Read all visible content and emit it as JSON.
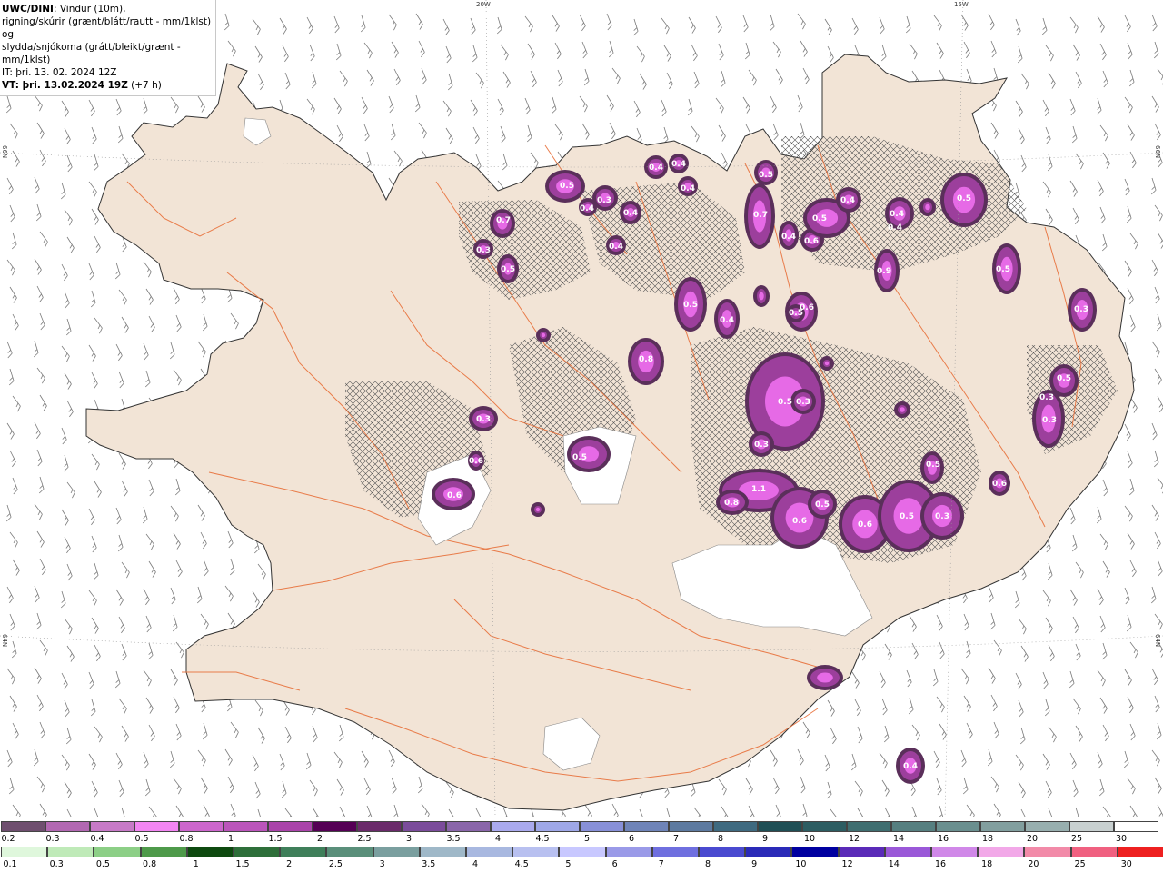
{
  "header": {
    "title_bold": "UWC/DINI",
    "title_rest": ": Vindur (10m),",
    "line2": "rigning/skúrir (grænt/blátt/rautt - mm/1klst) og",
    "line3": "slydda/snjókoma (grátt/bleikt/grænt - mm/1klst)",
    "line4": "IT: þri. 13. 02. 2024 12Z",
    "vt_bold": "VT: þri. 13.02.2024 19Z",
    "vt_rest": " (+7 h)"
  },
  "grid_labels": {
    "top_20w": "20W",
    "top_15w": "15W",
    "left_66n": "66N",
    "left_64n": "64N",
    "right_66n": "66N",
    "right_64n": "64N"
  },
  "colors": {
    "land": "#f2e4d6",
    "coast": "#333333",
    "roads": "#e8703a",
    "snow_dark": "#5a2f5a",
    "snow_mid": "#9c3f9c",
    "snow_light": "#e66ae6",
    "ice": "#ffffff",
    "wind_barb": "#7a7a7a"
  },
  "legend_top": {
    "labels": [
      "0.2",
      "0.3",
      "0.4",
      "0.5",
      "0.8",
      "1",
      "1.5",
      "2",
      "2.5",
      "3",
      "3.5",
      "4",
      "4.5",
      "5",
      "6",
      "7",
      "8",
      "9",
      "10",
      "12",
      "14",
      "16",
      "18",
      "20",
      "25",
      "30"
    ],
    "colors": [
      "#6f4f6f",
      "#b268b2",
      "#c77ac7",
      "#f285f2",
      "#cc66cc",
      "#bb55bb",
      "#aa44aa",
      "#550055",
      "#6a2a6a",
      "#7b4c9b",
      "#8a66aa",
      "#aaaaee",
      "#9fa8e8",
      "#8890d8",
      "#6f84b8",
      "#5d7aa0",
      "#3f6a80",
      "#1f4f55",
      "#2d5d62",
      "#3f6e70",
      "#567f80",
      "#6a8f8f",
      "#829f9f",
      "#98afaf",
      "#c8d0d0",
      "#ffffff"
    ]
  },
  "legend_bottom": {
    "labels": [
      "0.1",
      "0.3",
      "0.5",
      "0.8",
      "1",
      "1.5",
      "2",
      "2.5",
      "3",
      "3.5",
      "4",
      "4.5",
      "5",
      "6",
      "7",
      "8",
      "9",
      "10",
      "12",
      "14",
      "16",
      "18",
      "20",
      "25",
      "30"
    ],
    "colors": [
      "#dff7dc",
      "#bfeab8",
      "#8ccf86",
      "#4e9a4a",
      "#0e4a10",
      "#2e6f3a",
      "#3f7f5a",
      "#5a8f7a",
      "#7a9f9f",
      "#9fb8c8",
      "#a8b8e0",
      "#b8c0f0",
      "#c8c8ff",
      "#9a9ae8",
      "#6f6fdf",
      "#4a4ad0",
      "#2a2ab8",
      "#0000a0",
      "#5a2ab8",
      "#9a58d8",
      "#d088e8",
      "#f2a8e8",
      "#f28aa8",
      "#f06080",
      "#ee2020"
    ]
  },
  "precip_labels": [
    "0.5",
    "0.7",
    "0.3",
    "0.5",
    "0.4",
    "0.3",
    "0.4",
    "0.4",
    "0.4",
    "0.4",
    "0.4",
    "0.5",
    "0.7",
    "0.4",
    "0.6",
    "0.5",
    "0.4",
    "0.4",
    "0.4",
    "0.9",
    "0.5",
    "0.5",
    "0.3",
    "0.6",
    "0.5",
    "0.4",
    "0.5",
    "0.8",
    "0.3",
    "0.5",
    "0.6",
    "0.6",
    "0.5",
    "0.3",
    "0.3",
    "0.5",
    "0.3",
    "0.3",
    "0.5",
    "0.6",
    "1.1",
    "0.8",
    "0.6",
    "0.5",
    "0.6",
    "0.5",
    "0.3",
    "0.4"
  ]
}
